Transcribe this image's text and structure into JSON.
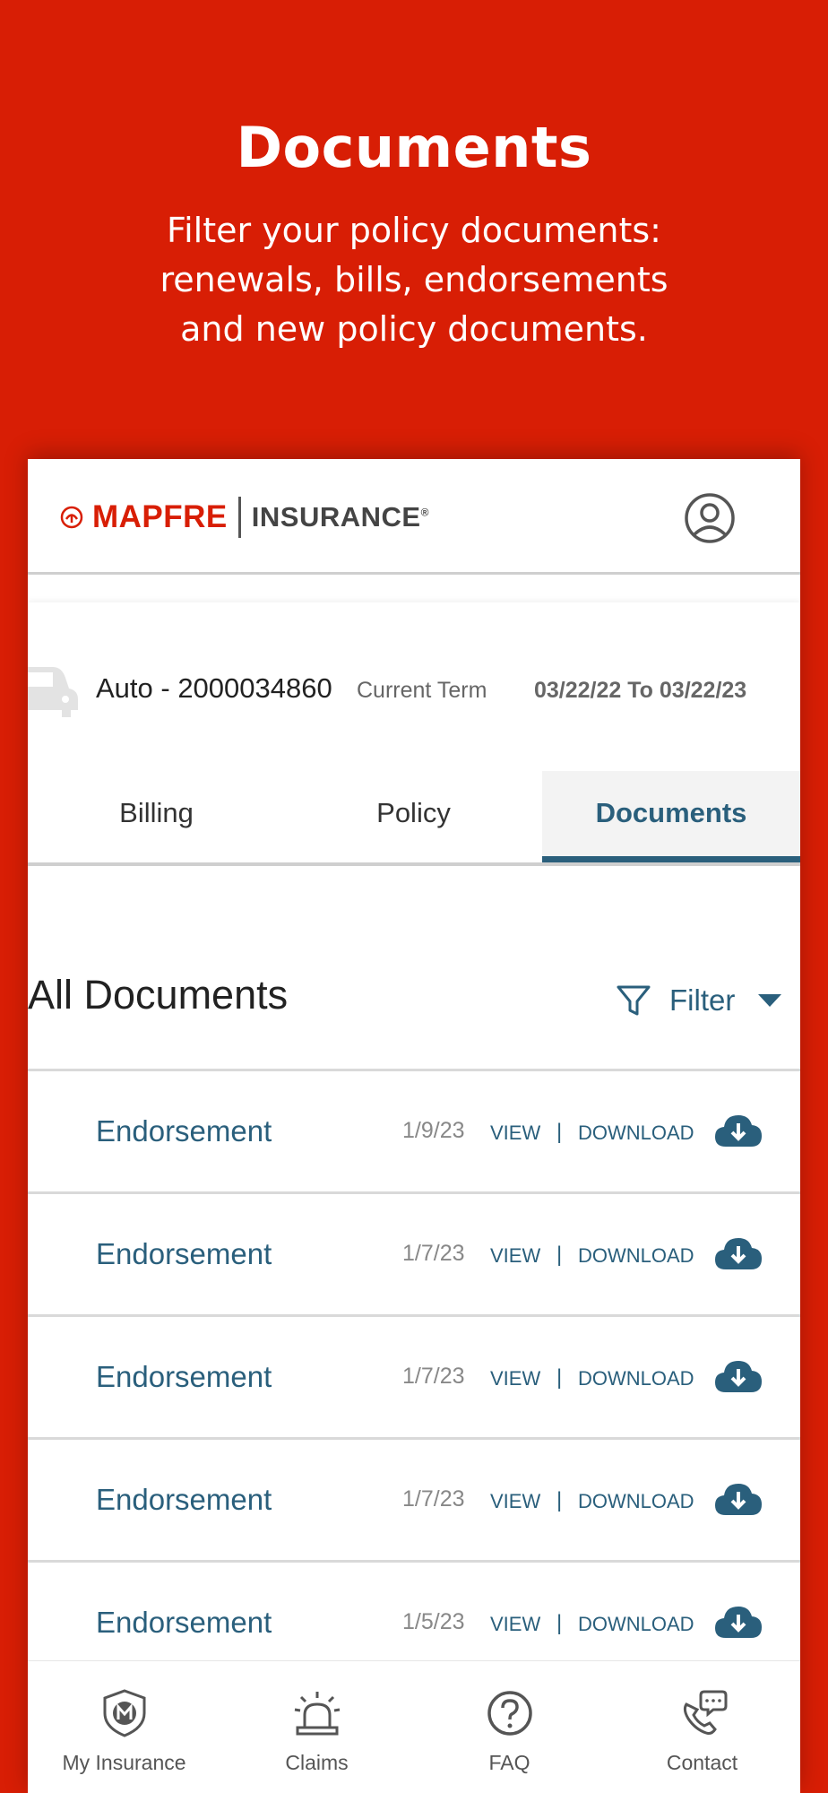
{
  "promo": {
    "title": "Documents",
    "subtitle": "Filter your policy documents: renewals, bills, endorsements and new policy documents."
  },
  "header": {
    "brand": "MAPFRE",
    "insurance": "INSURANCE",
    "registered": "®",
    "profile_icon": "user-circle-icon"
  },
  "policy": {
    "name": "Auto - 2000034860",
    "term_label": "Current Term",
    "dates": "03/22/22 To 03/22/23",
    "icon": "car-icon"
  },
  "tabs": [
    {
      "label": "Billing",
      "active": false
    },
    {
      "label": "Policy",
      "active": false
    },
    {
      "label": "Documents",
      "active": true
    }
  ],
  "documents": {
    "title": "All Documents",
    "filter_label": "Filter",
    "view_label": "VIEW",
    "separator": "|",
    "download_label": "DOWNLOAD",
    "items": [
      {
        "title": "Endorsement",
        "date": "1/9/23"
      },
      {
        "title": "Endorsement",
        "date": "1/7/23"
      },
      {
        "title": "Endorsement",
        "date": "1/7/23"
      },
      {
        "title": "Endorsement",
        "date": "1/7/23"
      },
      {
        "title": "Endorsement",
        "date": "1/5/23"
      }
    ]
  },
  "bottom_nav": [
    {
      "label": "My Insurance",
      "icon": "shield-m-icon"
    },
    {
      "label": "Claims",
      "icon": "siren-icon"
    },
    {
      "label": "FAQ",
      "icon": "question-icon"
    },
    {
      "label": "Contact",
      "icon": "phone-chat-icon"
    }
  ],
  "colors": {
    "brand_red": "#d81e05",
    "accent_blue": "#2a5f7c"
  }
}
